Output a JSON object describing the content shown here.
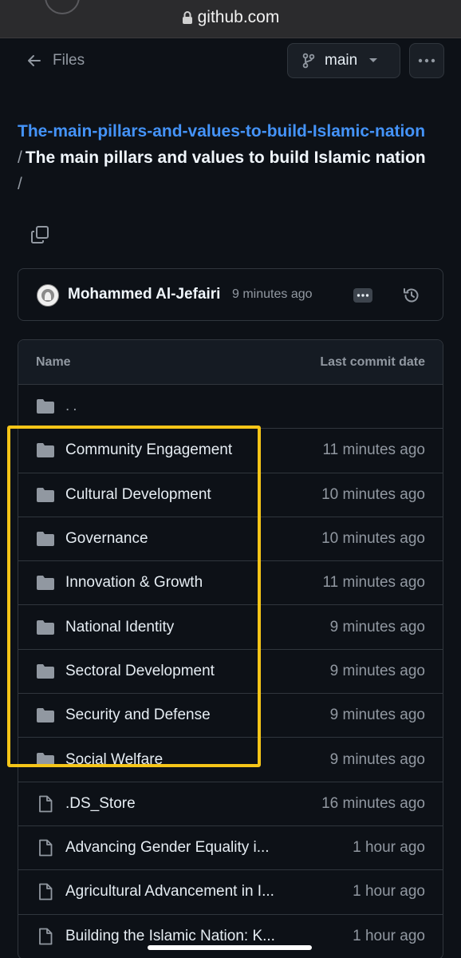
{
  "browser": {
    "url": "github.com"
  },
  "header": {
    "back_label": "Files",
    "branch": "main"
  },
  "breadcrumb": {
    "repo": "The-main-pillars-and-values-to-build-Islamic-nation",
    "separator": "/",
    "folder": "The main pillars and values to build Islamic nation",
    "trailing_separator": "/"
  },
  "commit": {
    "author": "Mohammed Al-Jefairi",
    "time": "9 minutes ago"
  },
  "table": {
    "col_name": "Name",
    "col_date": "Last commit date",
    "parent": "..",
    "rows": [
      {
        "type": "folder",
        "name": "Community Engagement",
        "date": "11 minutes ago"
      },
      {
        "type": "folder",
        "name": "Cultural Development",
        "date": "10 minutes ago"
      },
      {
        "type": "folder",
        "name": "Governance",
        "date": "10 minutes ago"
      },
      {
        "type": "folder",
        "name": "Innovation & Growth",
        "date": "11 minutes ago"
      },
      {
        "type": "folder",
        "name": "National Identity",
        "date": "9 minutes ago"
      },
      {
        "type": "folder",
        "name": "Sectoral Development",
        "date": "9 minutes ago"
      },
      {
        "type": "folder",
        "name": "Security and Defense",
        "date": "9 minutes ago"
      },
      {
        "type": "folder",
        "name": "Social Welfare",
        "date": "9 minutes ago"
      },
      {
        "type": "file",
        "name": ".DS_Store",
        "date": "16 minutes ago"
      },
      {
        "type": "file",
        "name": "Advancing Gender Equality i...",
        "date": "1 hour ago"
      },
      {
        "type": "file",
        "name": "Agricultural Advancement in I...",
        "date": "1 hour ago"
      },
      {
        "type": "file",
        "name": "Building the Islamic Nation: K...",
        "date": "1 hour ago"
      }
    ]
  },
  "colors": {
    "background": "#0d1117",
    "link": "#4493f8",
    "highlight": "#f5c518",
    "muted": "#9198a1"
  }
}
